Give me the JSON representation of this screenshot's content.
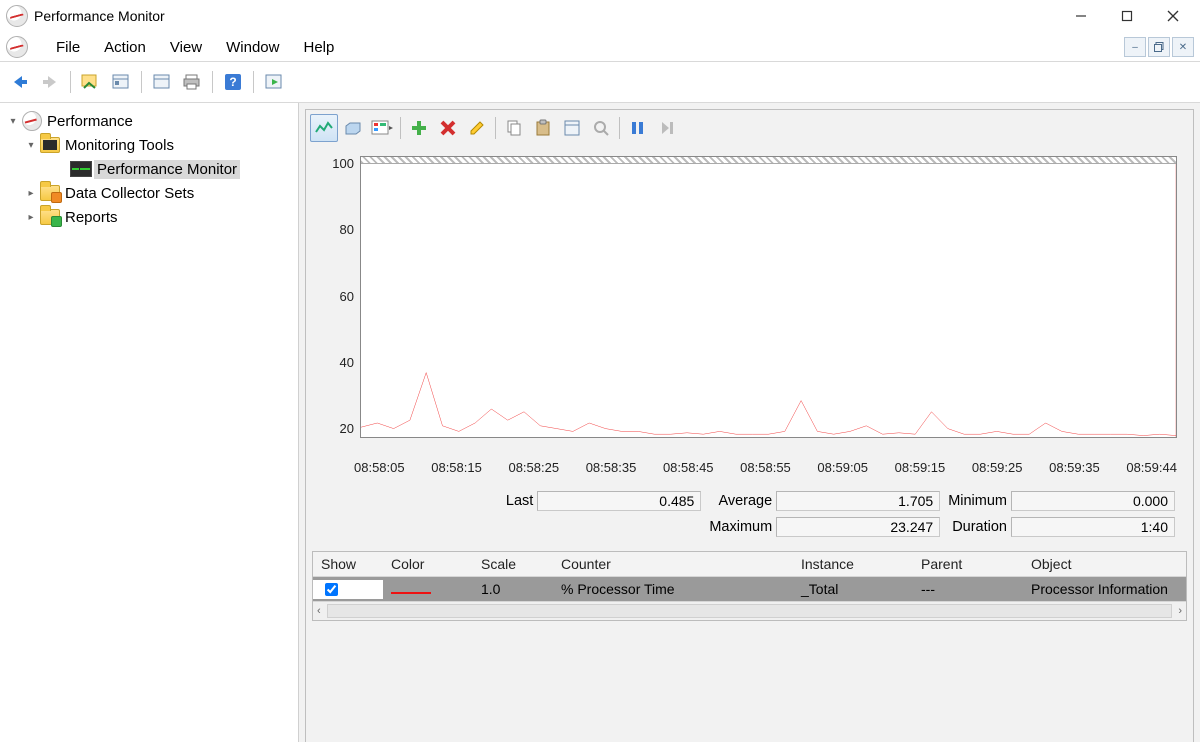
{
  "window": {
    "title": "Performance Monitor"
  },
  "menu": {
    "file": "File",
    "action": "Action",
    "view": "View",
    "window": "Window",
    "help": "Help"
  },
  "tree": {
    "root": "Performance",
    "monitoring_tools": "Monitoring Tools",
    "performance_monitor": "Performance Monitor",
    "data_collector_sets": "Data Collector Sets",
    "reports": "Reports"
  },
  "stats": {
    "last_label": "Last",
    "last_value": "0.485",
    "average_label": "Average",
    "average_value": "1.705",
    "minimum_label": "Minimum",
    "minimum_value": "0.000",
    "maximum_label": "Maximum",
    "maximum_value": "23.247",
    "duration_label": "Duration",
    "duration_value": "1:40"
  },
  "grid": {
    "headers": {
      "show": "Show",
      "color": "Color",
      "scale": "Scale",
      "counter": "Counter",
      "instance": "Instance",
      "parent": "Parent",
      "object": "Object"
    },
    "row0": {
      "scale": "1.0",
      "counter": "% Processor Time",
      "instance": "_Total",
      "parent": "---",
      "object": "Processor Information",
      "color": "#e11",
      "checked": true
    }
  },
  "chart_data": {
    "type": "line",
    "title": "",
    "xlabel": "",
    "ylabel": "",
    "ylim": [
      0,
      100
    ],
    "yticks": [
      100,
      80,
      60,
      40,
      20
    ],
    "xticks": [
      "08:58:05",
      "08:58:10",
      "08:58:15",
      "08:58:20",
      "08:58:25",
      "08:58:30",
      "08:58:35",
      "08:58:40",
      "08:58:45",
      "08:58:50",
      "08:58:55",
      "08:59:00",
      "08:59:05",
      "08:59:10",
      "08:59:15",
      "08:59:20",
      "08:59:25",
      "08:59:30",
      "08:59:35",
      "08:59:40",
      "08:59:44"
    ],
    "xticks_shown": [
      "08:58:05",
      "08:58:15",
      "08:58:25",
      "08:58:35",
      "08:58:45",
      "08:58:55",
      "08:59:05",
      "08:59:15",
      "08:59:25",
      "08:59:35",
      "08:59:44"
    ],
    "series": [
      {
        "name": "% Processor Time",
        "color": "#e11",
        "values": [
          3.5,
          5,
          3,
          6,
          23,
          4,
          2,
          5,
          10,
          6,
          9,
          4,
          3,
          2,
          5,
          3,
          2,
          2,
          1,
          1,
          1.5,
          1,
          2,
          1,
          1,
          1,
          2,
          13,
          2,
          1,
          2,
          4,
          1,
          1.5,
          1,
          9,
          3,
          1,
          1,
          2,
          1,
          1,
          5,
          2,
          1,
          1,
          1,
          1,
          0.5,
          1,
          0.5
        ]
      }
    ]
  }
}
